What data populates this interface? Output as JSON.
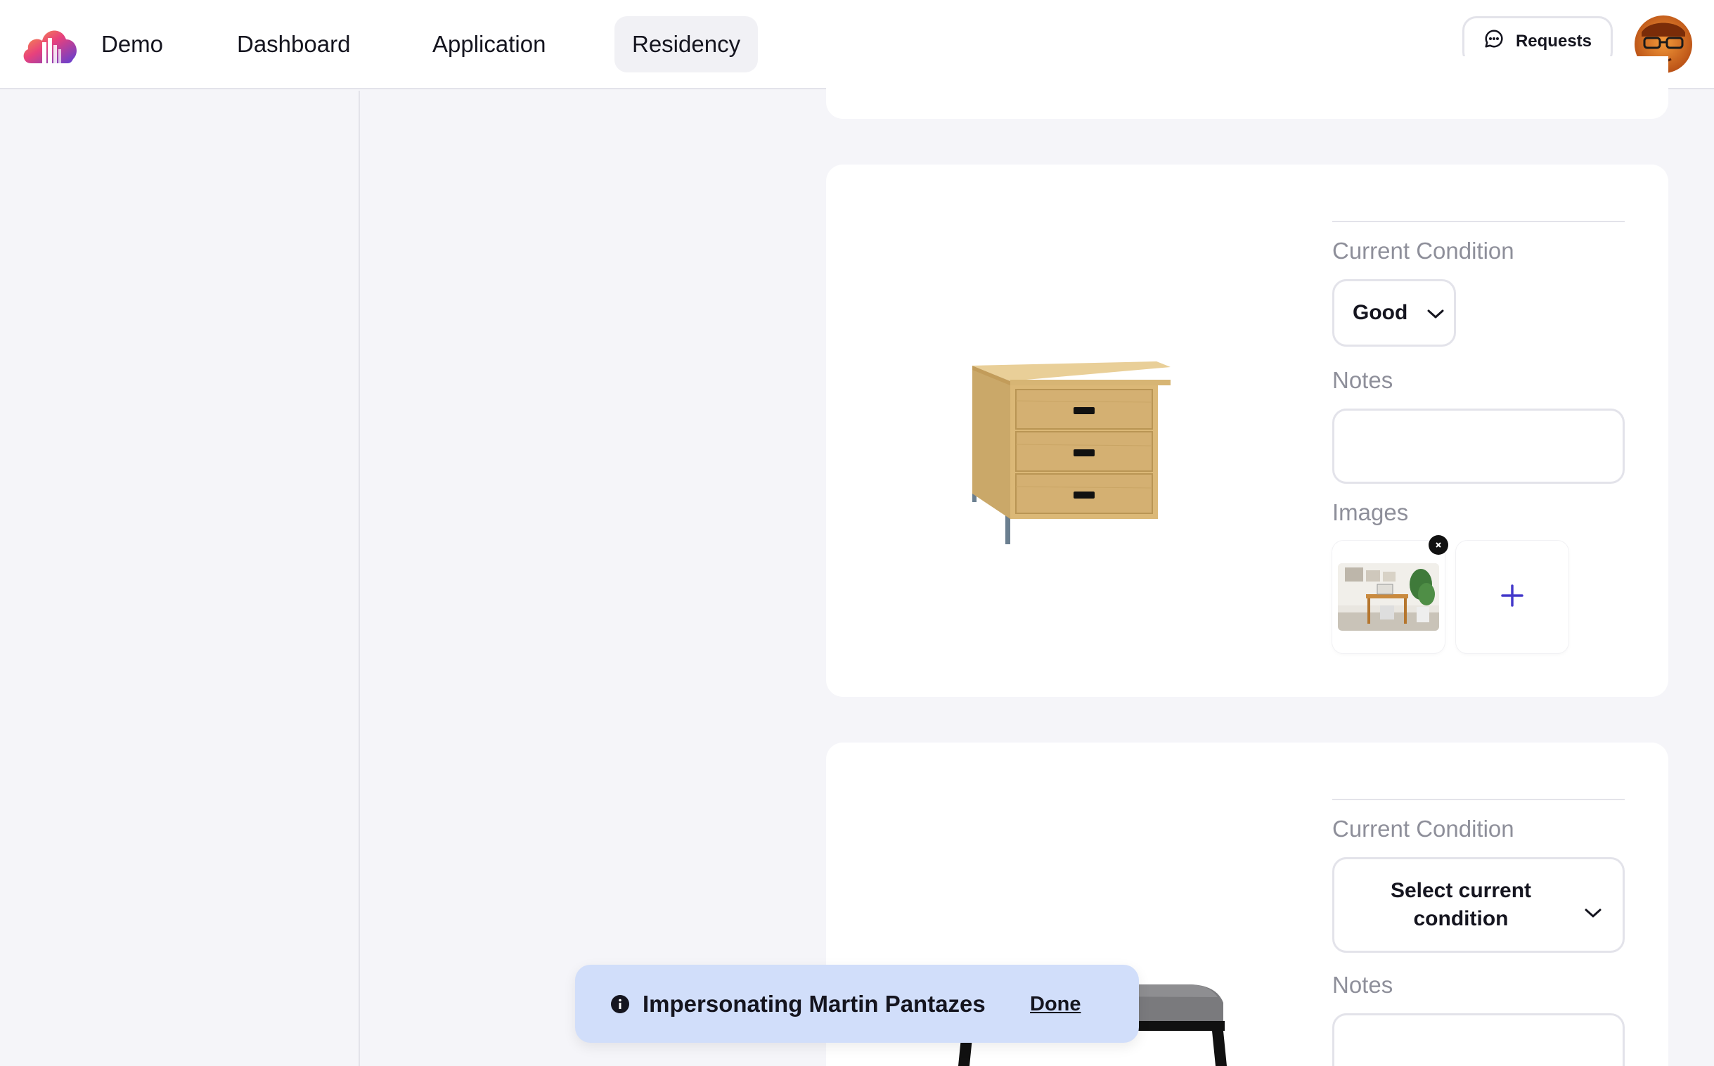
{
  "header": {
    "brand": "Demo",
    "nav": [
      "Dashboard",
      "Application",
      "Residency"
    ],
    "active_nav": "Residency",
    "requests_label": "Requests"
  },
  "items": [
    {
      "furniture_icon": "dresser",
      "condition_label": "Current Condition",
      "condition_value": "Good",
      "notes_label": "Notes",
      "notes_value": "",
      "images_label": "Images",
      "image_count": 1
    },
    {
      "furniture_icon": "bench",
      "condition_label": "Current Condition",
      "condition_value": "Select current condition",
      "notes_label": "Notes",
      "notes_value": ""
    }
  ],
  "toast": {
    "message": "Impersonating Martin Pantazes",
    "action": "Done"
  },
  "colors": {
    "background": "#f5f5f9",
    "toast_bg": "#d1defa",
    "accent": "#4338ca",
    "muted_label": "#8e8f9a"
  }
}
